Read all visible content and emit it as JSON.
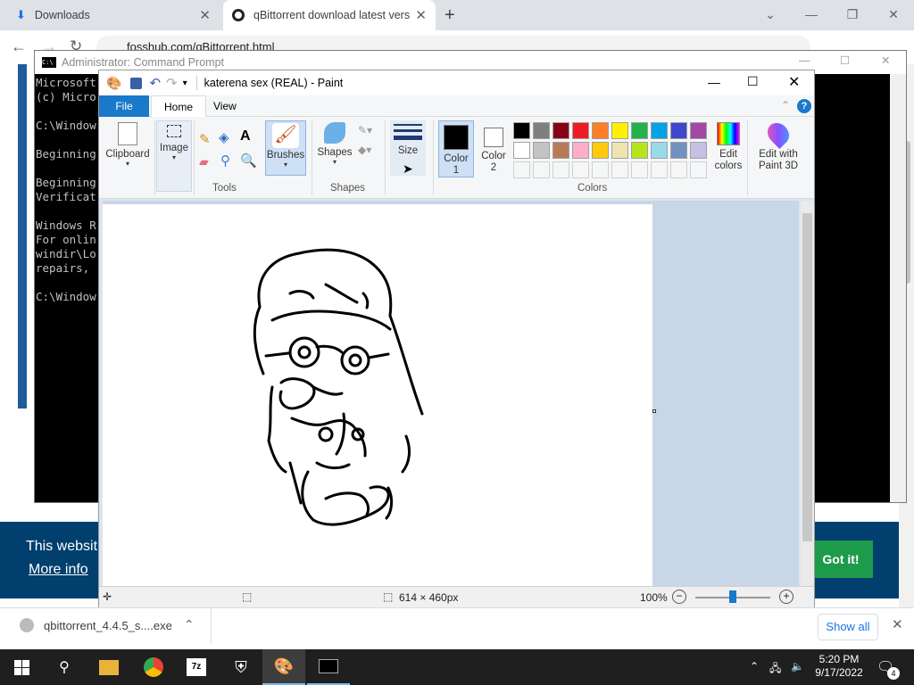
{
  "chrome": {
    "tabs": [
      {
        "title": "Downloads",
        "icon": "download-icon"
      },
      {
        "title": "qBittorrent download latest versi",
        "icon": "qbittorrent-icon"
      }
    ],
    "new_tab_icon": "plus-icon",
    "url": "fosshub.com/qBittorrent.html"
  },
  "cmd": {
    "title": "Administrator: Command Prompt",
    "lines": [
      "Microsoft",
      "(c) Micro",
      "",
      "C:\\Window",
      "",
      "Beginning",
      "",
      "Beginning",
      "Verificat",
      "",
      "Windows R",
      "For onlin",
      "windir\\Lo",
      "repairs, ",
      "",
      "C:\\Window"
    ]
  },
  "paint": {
    "title": "katerena sex (REAL) - Paint",
    "tabs": {
      "file": "File",
      "home": "Home",
      "view": "View"
    },
    "ribbon": {
      "clipboard": "Clipboard",
      "image": "Image",
      "tools": "Tools",
      "brushes": "Brushes",
      "shapes": "Shapes",
      "shapes_group": "Shapes",
      "size": "Size",
      "color1": "Color 1",
      "color2": "Color 2",
      "colors_group": "Colors",
      "edit_colors": "Edit colors",
      "edit_paint3d": "Edit with Paint 3D"
    },
    "palette_row1": [
      "#000000",
      "#7f7f7f",
      "#880015",
      "#ed1c24",
      "#ff7f27",
      "#fff200",
      "#22b14c",
      "#00a2e8",
      "#3f48cc",
      "#a349a4"
    ],
    "palette_row2": [
      "#ffffff",
      "#c3c3c3",
      "#b97a57",
      "#ffaec9",
      "#ffc90e",
      "#efe4b0",
      "#b5e61d",
      "#99d9ea",
      "#7092be",
      "#c8bfe7"
    ],
    "status": {
      "dimensions": "614 × 460px",
      "zoom": "100%"
    }
  },
  "page": {
    "cookie_text": "This websit",
    "more_info": "More info",
    "got_it": "Got it!"
  },
  "download": {
    "filename": "qbittorrent_4.4.5_s....exe",
    "show_all": "Show all"
  },
  "taskbar": {
    "time": "5:20 PM",
    "date": "9/17/2022",
    "notifications": "4"
  }
}
